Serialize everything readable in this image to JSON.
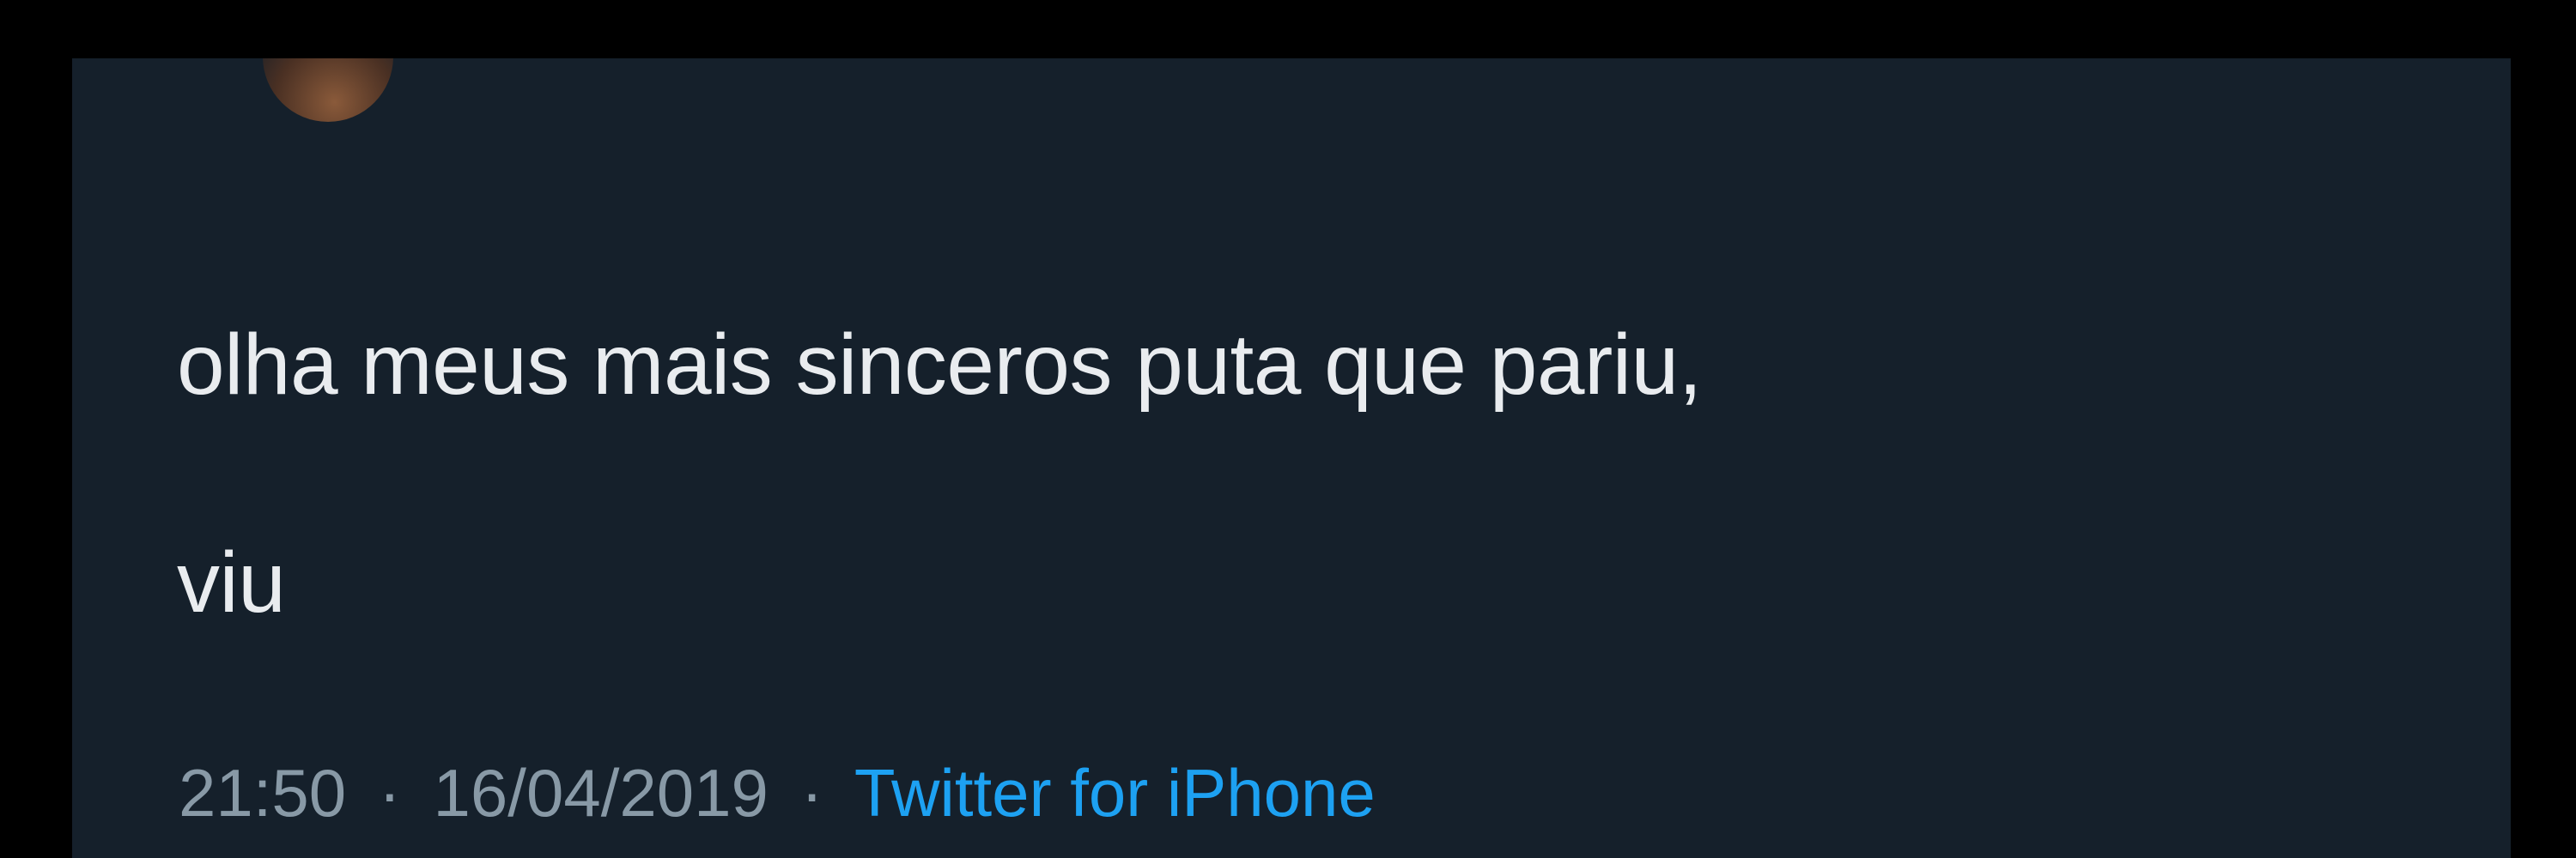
{
  "tweet": {
    "text_lines": [
      "olha meus mais sinceros puta que pariu,",
      "viu"
    ],
    "time": "21:50",
    "date": "16/04/2019",
    "separator": "·",
    "source": "Twitter for iPhone"
  },
  "colors": {
    "outer_background": "#000000",
    "card_background": "#15202b",
    "text": "#e9ecef",
    "meta_text": "#8899a6",
    "link": "#1da1f2"
  }
}
